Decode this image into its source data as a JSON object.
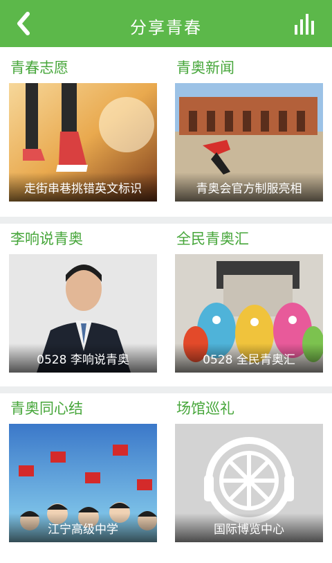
{
  "header": {
    "title": "分享青春",
    "back_icon": "chevron-left-icon",
    "stats_icon": "bar-chart-icon",
    "color": "#5cb84a"
  },
  "cards": [
    {
      "title": "青春志愿",
      "caption": "走街串巷挑错英文标识"
    },
    {
      "title": "青奥新闻",
      "caption": "青奥会官方制服亮相"
    },
    {
      "title": "李响说青奥",
      "caption": "0528 李响说青奥"
    },
    {
      "title": "全民青奥汇",
      "caption": "0528 全民青奥汇"
    },
    {
      "title": "青奥同心结",
      "caption": "江宁高级中学"
    },
    {
      "title": "场馆巡礼",
      "caption": "国际博览中心"
    }
  ],
  "colors": {
    "accent": "#5cb84a",
    "section_title": "#46a63a",
    "divider": "#eceeef"
  }
}
